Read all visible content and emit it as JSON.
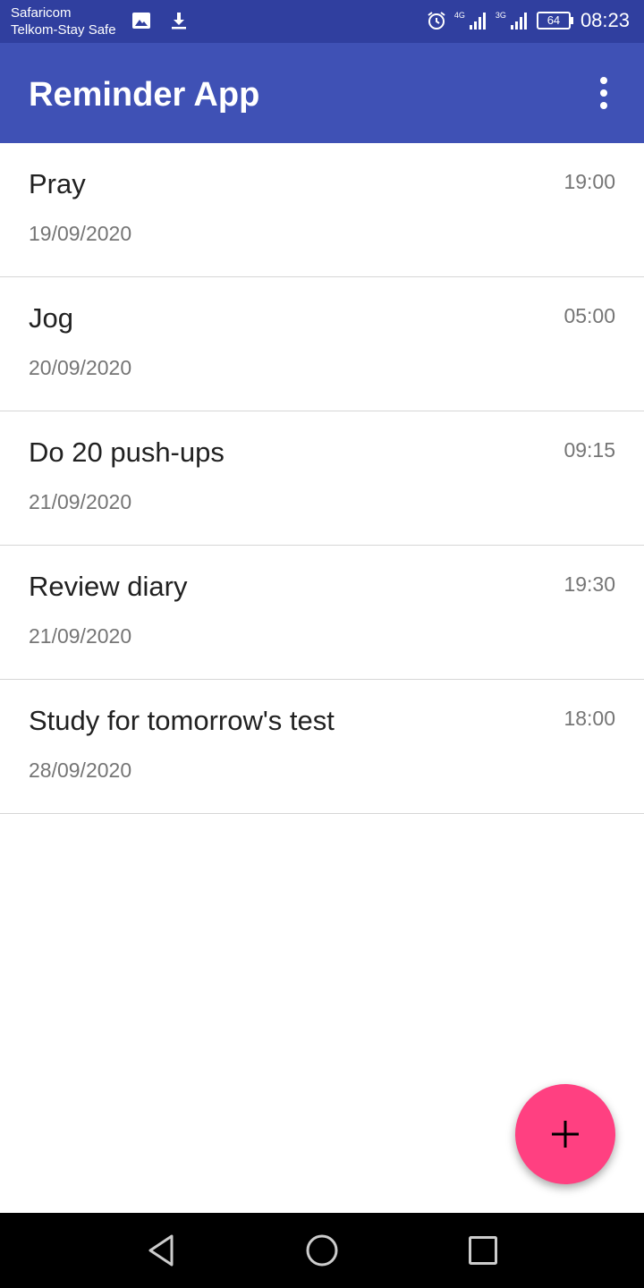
{
  "status_bar": {
    "carrier_1": "Safaricom",
    "carrier_2": "Telkom-Stay Safe",
    "network_1": "4G",
    "network_2": "3G",
    "battery": "64",
    "time": "08:23"
  },
  "app_bar": {
    "title": "Reminder App"
  },
  "reminders": [
    {
      "title": "Pray",
      "date": "19/09/2020",
      "time": "19:00"
    },
    {
      "title": "Jog",
      "date": "20/09/2020",
      "time": "05:00"
    },
    {
      "title": "Do 20 push-ups",
      "date": "21/09/2020",
      "time": "09:15"
    },
    {
      "title": "Review diary",
      "date": "21/09/2020",
      "time": "19:30"
    },
    {
      "title": "Study for tomorrow's test",
      "date": "28/09/2020",
      "time": "18:00"
    }
  ],
  "colors": {
    "status_bar": "#303f9f",
    "app_bar": "#3f51b5",
    "fab": "#ff4081"
  },
  "icons": {
    "fab": "plus-icon",
    "menu": "more-vert-icon",
    "nav": [
      "back-icon",
      "home-icon",
      "recents-icon"
    ]
  }
}
